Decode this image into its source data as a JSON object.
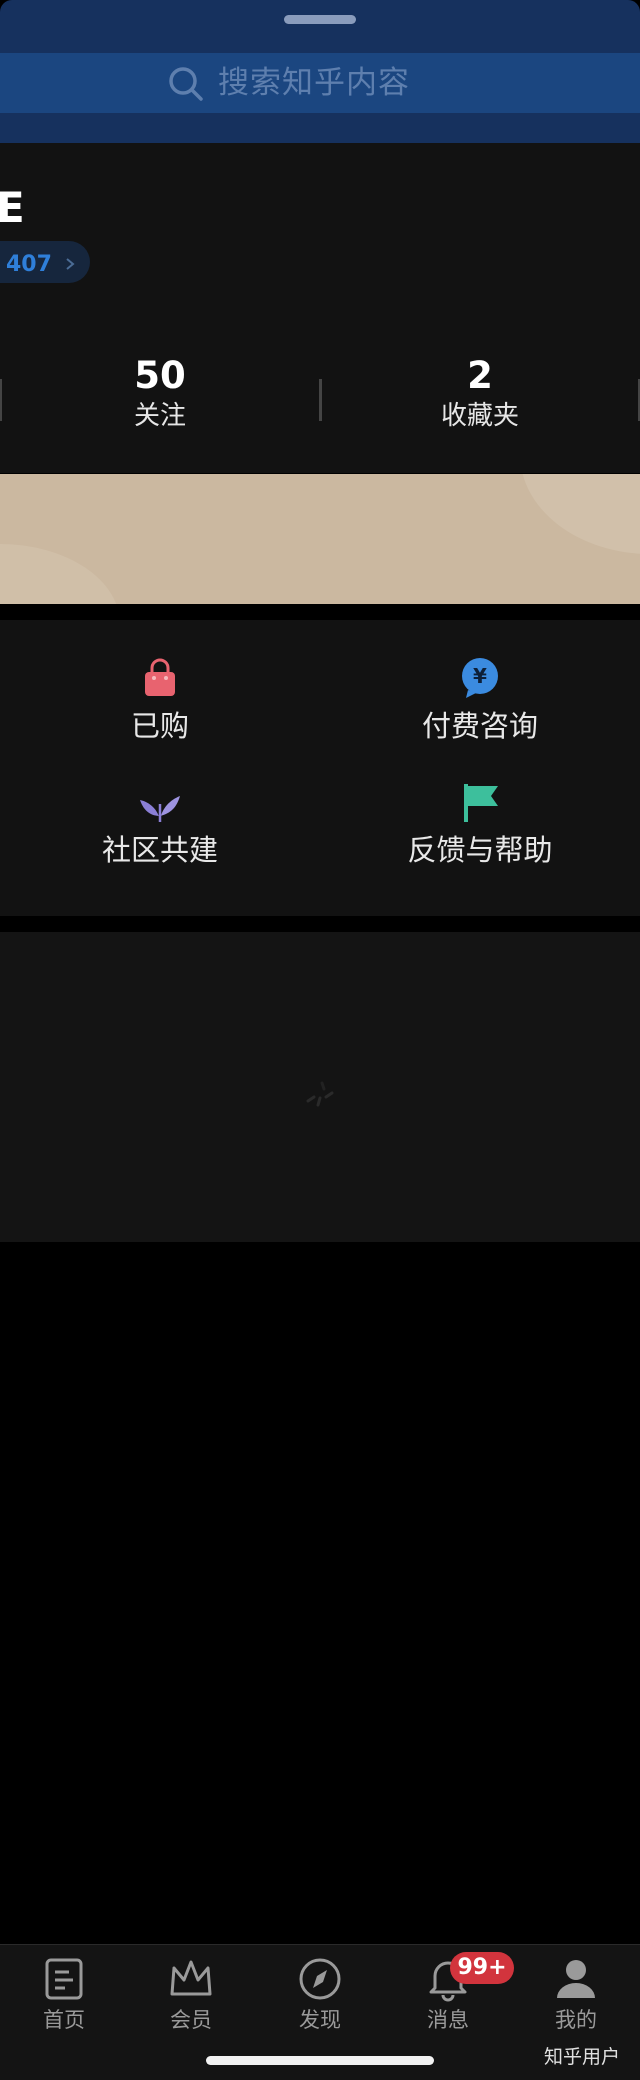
{
  "search": {
    "placeholder": "搜索知乎内容"
  },
  "profile": {
    "name_fragment": "E",
    "badge_count": "407"
  },
  "stats": [
    {
      "value": "50",
      "label": "关注"
    },
    {
      "value": "2",
      "label": "收藏夹"
    }
  ],
  "services": [
    {
      "label": "已购",
      "icon": "shopping-bag-icon",
      "color": "#e8636f"
    },
    {
      "label": "付费咨询",
      "icon": "yuan-chat-icon",
      "color": "#3b8be0"
    },
    {
      "label": "社区共建",
      "icon": "sprout-icon",
      "color": "#8b7fd6"
    },
    {
      "label": "反馈与帮助",
      "icon": "flag-icon",
      "color": "#3dbf9c"
    }
  ],
  "tabs": [
    {
      "label": "首页",
      "icon": "home-icon"
    },
    {
      "label": "会员",
      "icon": "crown-icon"
    },
    {
      "label": "发现",
      "icon": "compass-icon"
    },
    {
      "label": "消息",
      "icon": "bell-icon"
    },
    {
      "label": "我的",
      "icon": "person-icon"
    }
  ],
  "notifications": {
    "badge": "99+",
    "color": "#d2343d"
  },
  "watermark": "知乎用户",
  "colors": {
    "accent": "#2f7fd9",
    "header": "#16315e",
    "banner": "#cbb8a0"
  }
}
